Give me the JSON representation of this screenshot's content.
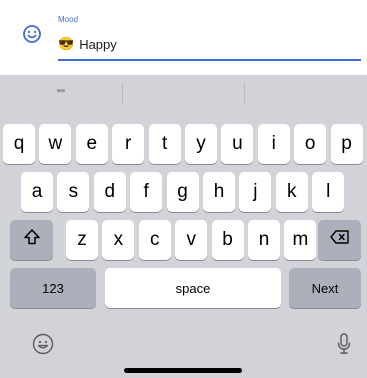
{
  "field": {
    "label": "Mood",
    "emoji": "😎",
    "value": "Happy"
  },
  "suggestions": [
    "””",
    "",
    ""
  ],
  "keyboard": {
    "row1": [
      "q",
      "w",
      "e",
      "r",
      "t",
      "y",
      "u",
      "i",
      "o",
      "p"
    ],
    "row2": [
      "a",
      "s",
      "d",
      "f",
      "g",
      "h",
      "j",
      "k",
      "l"
    ],
    "row3": [
      "z",
      "x",
      "c",
      "v",
      "b",
      "n",
      "m"
    ],
    "numbers_label": "123",
    "space_label": "space",
    "next_label": "Next"
  },
  "icons": {
    "field_icon": "smiley-icon",
    "shift": "shift-icon",
    "delete": "delete-icon",
    "emoji": "emoji-icon",
    "dictation": "microphone-icon"
  },
  "colors": {
    "accent": "#3b6fd6",
    "keyboard_bg": "#d1d3d9",
    "key": "#ffffff",
    "dark_key": "#abb0ba"
  }
}
